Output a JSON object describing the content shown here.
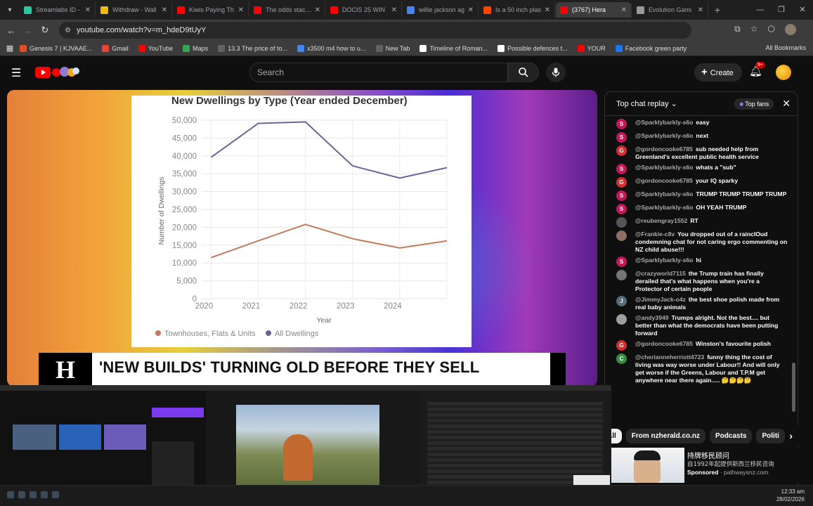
{
  "browser": {
    "tabs": [
      {
        "label": "Streamlabs ID -",
        "color": "#31c3a2"
      },
      {
        "label": "Withdraw - Wall",
        "color": "#f0b90b"
      },
      {
        "label": "Kiwis Paying Th",
        "color": "#ff0000"
      },
      {
        "label": "The odds stacke",
        "color": "#ff0000"
      },
      {
        "label": "DOCIS 25 WIN",
        "color": "#ff0000"
      },
      {
        "label": "willie jackson ag",
        "color": "#4285f4"
      },
      {
        "label": "Is a 50 inch plas",
        "color": "#ff4500"
      },
      {
        "label": "(3767) Hera",
        "color": "#ff0000",
        "active": true
      },
      {
        "label": "Evolution Gami",
        "color": "#999999"
      }
    ],
    "url": "youtube.com/watch?v=m_hdeD9tUyY",
    "bookmarks": [
      {
        "label": "Genesis 7 | KJVAAE...",
        "color": "#e34c26"
      },
      {
        "label": "Gmail",
        "color": "#ea4335"
      },
      {
        "label": "YouTube",
        "color": "#ff0000"
      },
      {
        "label": "Maps",
        "color": "#34a853"
      },
      {
        "label": "13.3 The price of to...",
        "color": "#5f6368"
      },
      {
        "label": "x3500 m4 how to u...",
        "color": "#4285f4"
      },
      {
        "label": "New Tab",
        "color": "#5f6368"
      },
      {
        "label": "Timeline of Roman...",
        "color": "#ffffff"
      },
      {
        "label": "Possible defences t...",
        "color": "#ffffff"
      },
      {
        "label": "YOUR",
        "color": "#ff0000"
      },
      {
        "label": "Facebook green party",
        "color": "#1877f2"
      }
    ],
    "all_bookmarks_label": "All Bookmarks"
  },
  "youtube": {
    "search_placeholder": "Search",
    "create_label": "Create",
    "notification_count": "9+"
  },
  "video": {
    "headline": "'NEW BUILDS' TURNING OLD BEFORE THEY SELL",
    "logo_glyph": "H"
  },
  "chart_data": {
    "type": "line",
    "title": "New Dwellings by Type (Year ended December)",
    "xlabel": "Year",
    "ylabel": "Number of Dwellings",
    "ylim": [
      0,
      50000
    ],
    "yticks": [
      "0",
      "5,000",
      "10,000",
      "15,000",
      "20,000",
      "25,000",
      "30,000",
      "35,000",
      "40,000",
      "45,000",
      "50,000"
    ],
    "xticks": [
      "2020",
      "2021",
      "2022",
      "2023",
      "2024"
    ],
    "x": [
      2020,
      2021,
      2022,
      2023,
      2024,
      2025
    ],
    "series": [
      {
        "name": "Townhouses, Flats & Units",
        "color": "#c47a5c",
        "values": [
          11500,
          16200,
          20800,
          16800,
          14200,
          16200
        ]
      },
      {
        "name": "All Dwellings",
        "color": "#6b6494",
        "values": [
          39600,
          49100,
          49500,
          37200,
          33800,
          36700
        ]
      }
    ],
    "grid": true,
    "legend": "bottom"
  },
  "chat": {
    "title": "Top chat replay",
    "top_fans_label": "Top fans",
    "messages": [
      {
        "author": "@Sparklybarkly-s6o",
        "text": "easy",
        "initial": "S",
        "color": "#c2185b"
      },
      {
        "author": "@Sparklybarkly-s6o",
        "text": "next",
        "initial": "S",
        "color": "#c2185b"
      },
      {
        "author": "@gordoncooke6785",
        "text": "sub needed help from Greenland's excellent public health service",
        "initial": "G",
        "color": "#d32f2f"
      },
      {
        "author": "@Sparklybarkly-s6o",
        "text": "whats a \"sub\"",
        "initial": "S",
        "color": "#c2185b"
      },
      {
        "author": "@gordoncooke6785",
        "text": "your IQ sparky",
        "initial": "G",
        "color": "#d32f2f"
      },
      {
        "author": "@Sparklybarkly-s6o",
        "text": "TRUMP TRUMP TRUMP TRUMP",
        "initial": "S",
        "color": "#c2185b"
      },
      {
        "author": "@Sparklybarkly-s6o",
        "text": "OH YEAH TRUMP",
        "initial": "S",
        "color": "#c2185b"
      },
      {
        "author": "@reubengray1552",
        "text": "RT",
        "initial": "",
        "color": "#555555"
      },
      {
        "author": "@Frankie-c8v",
        "text": "You dropped out of a rainclOud condemning chat for not caring ergo commenting on NZ child abuse!!!",
        "initial": "",
        "color": "#8d6e63"
      },
      {
        "author": "@Sparklybarkly-s6o",
        "text": "hi",
        "initial": "S",
        "color": "#c2185b"
      },
      {
        "author": "@crazyworld7115",
        "text": "the Trump train has finally derailed that's what happens when you're a Protector of certain people",
        "initial": "",
        "color": "#757575"
      },
      {
        "author": "@JimmyJack-o4z",
        "text": "the best shoe polish made from real baby animals",
        "initial": "J",
        "color": "#546e7a"
      },
      {
        "author": "@andy3949",
        "text": "Trumps alright. Not the best.... but better than what the democrats have been putting forward",
        "initial": "",
        "color": "#9e9e9e"
      },
      {
        "author": "@gordoncooke6785",
        "text": "Winston's favourite polish",
        "initial": "G",
        "color": "#d32f2f"
      },
      {
        "author": "@cherianneherriott4723",
        "text": "funny thing the cost of living was way worse under Labour!! And will only get worse if the Greens, Labour and T.P.M get anywhere near there again..... 🤔🤔🤔🤔",
        "initial": "C",
        "color": "#388e3c"
      }
    ]
  },
  "chips": [
    "All",
    "From nzherald.co.nz",
    "Podcasts",
    "Politi"
  ],
  "ad": {
    "title": "持牌移民顾问",
    "subtitle": "自1992年起提供新西兰移民咨询",
    "sponsored_label": "Sponsored",
    "domain": "pathwaysnz.com"
  },
  "taskbar": {
    "time": "12:33 am",
    "date": "28/02/2026"
  }
}
